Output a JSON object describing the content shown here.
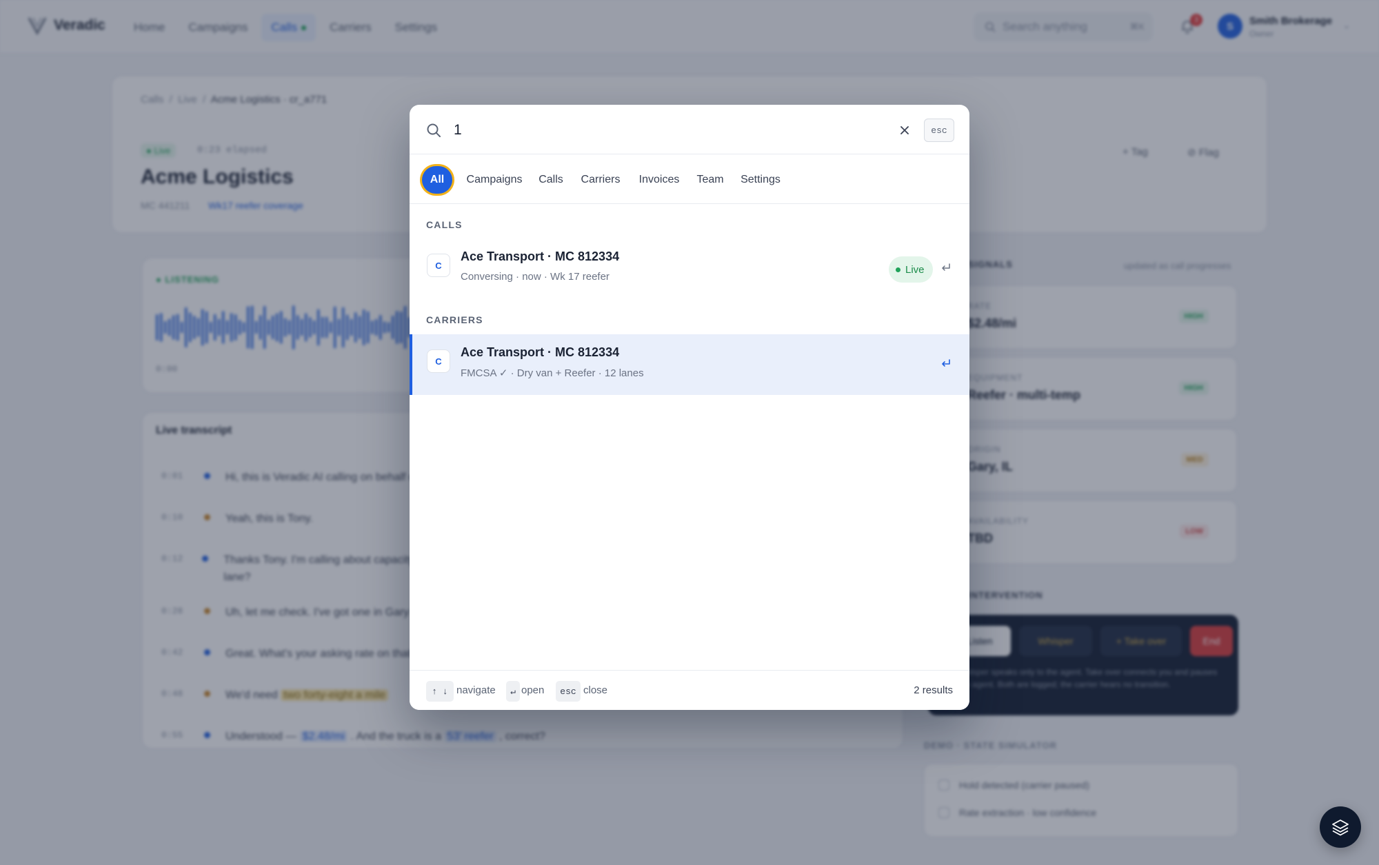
{
  "app": {
    "brand": "Veradic",
    "nav": [
      {
        "label": "Home"
      },
      {
        "label": "Campaigns"
      },
      {
        "label": "Calls",
        "active": true,
        "live_dot": true
      },
      {
        "label": "Carriers"
      },
      {
        "label": "Settings"
      }
    ],
    "search_placeholder": "Search anything",
    "search_shortcut": "⌘K",
    "notifications_count": "3",
    "user": {
      "initial": "S",
      "org": "Smith Brokerage",
      "role": "Owner"
    }
  },
  "background": {
    "breadcrumb": [
      "Calls",
      "Live",
      "Acme Logistics · cr_a771"
    ],
    "status_pill": "● Live",
    "elapsed": "0:23 elapsed",
    "title": "Acme Logistics",
    "mc": "MC 441211",
    "campaign_link": "Wk17 reefer coverage",
    "actions": {
      "tag": "+ Tag",
      "flag": "⊘ Flag"
    },
    "listening": "● LISTENING",
    "wave_time": "0:00",
    "transcript_title": "Live transcript",
    "transcript": [
      {
        "time": "0:01",
        "speaker": "agent",
        "text": "Hi, this is Veradic AI calling on behalf of Smith Brokerage."
      },
      {
        "time": "0:10",
        "speaker": "carrier",
        "text": "Yeah, this is Tony."
      },
      {
        "time": "0:12",
        "speaker": "agent",
        "text": "Thanks Tony. I'm calling about capacity on the Chicago to Dallas reefer lane?"
      },
      {
        "time": "0:28",
        "speaker": "carrier",
        "text": "Uh, let me check. I've got one in Gary tomorrow."
      },
      {
        "time": "0:42",
        "speaker": "agent",
        "text": "Great. What's your asking rate on that lane?"
      },
      {
        "time": "0:48",
        "speaker": "carrier",
        "pre": "We'd need ",
        "highlight": "two forty-eight a mile",
        "post": ""
      },
      {
        "time": "0:55",
        "speaker": "agent",
        "pre": "Understood — ",
        "highlight": "$2.48/mi",
        "mid": " . And the truck is a ",
        "highlight2": "53' reefer",
        "post": " , correct?"
      }
    ],
    "signals": {
      "title": "SIGNALS",
      "note": "updated as call progresses",
      "items": [
        {
          "label": "RATE",
          "value": "$2.48/mi",
          "badge": "HIGH"
        },
        {
          "label": "EQUIPMENT",
          "value": "Reefer · multi-temp",
          "badge": "HIGH"
        },
        {
          "label": "ORIGIN",
          "value": "Gary, IL",
          "badge": "MED"
        },
        {
          "label": "AVAILABILITY",
          "value": "TBD",
          "badge": "LOW"
        }
      ]
    },
    "intervention": {
      "title": "INTERVENTION",
      "buttons": [
        "Listen",
        "Whisper",
        "+ Take over",
        "End"
      ],
      "help": "Whisper speaks only to the agent. Take over connects you and pauses the agent. Both are logged; the carrier hears no transition."
    },
    "simulator": {
      "title": "DEMO · STATE SIMULATOR",
      "items": [
        "Hold detected (carrier paused)",
        "Rate extraction · low confidence"
      ]
    }
  },
  "palette": {
    "query": "1",
    "esc_label": "esc",
    "tabs": [
      "All",
      "Campaigns",
      "Calls",
      "Carriers",
      "Invoices",
      "Team",
      "Settings"
    ],
    "active_tab": "All",
    "sections": [
      {
        "title": "CALLS",
        "results": [
          {
            "chip": "C",
            "title": "Ace Transport · MC 812334",
            "subtitle": "Conversing · now · Wk 17 reefer",
            "badge": "Live",
            "selected": false
          }
        ]
      },
      {
        "title": "CARRIERS",
        "results": [
          {
            "chip": "C",
            "title": "Ace Transport · MC 812334",
            "subtitle": "FMCSA ✓ · Dry van + Reefer · 12 lanes",
            "badge": "",
            "selected": true
          }
        ]
      }
    ],
    "footer": {
      "keys": [
        {
          "keys": "↑ ↓",
          "label": "navigate"
        },
        {
          "keys": "↵",
          "label": "open"
        },
        {
          "keys": "esc",
          "label": "close"
        }
      ],
      "count": "2 results"
    }
  },
  "colors": {
    "accent": "#1f5fe0",
    "live": "#20a35a",
    "focus_ring": "#f2b21a",
    "dark_panel": "#0f1a2e"
  }
}
